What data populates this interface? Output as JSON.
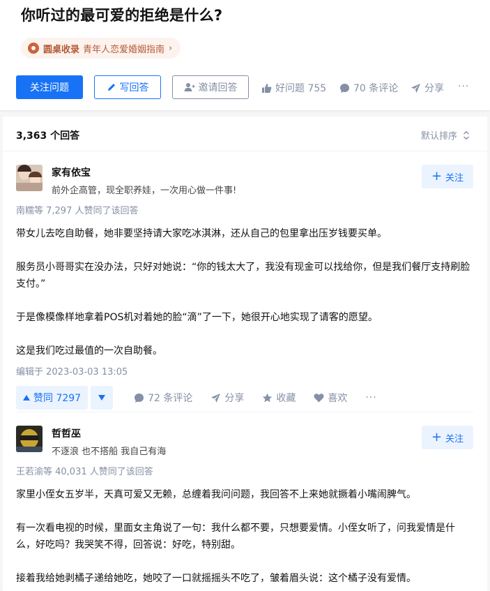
{
  "question": {
    "title": "你听过的最可爱的拒绝是什么?",
    "topic_brand": "圆桌收录",
    "topic_name": "青年人恋爱婚姻指南",
    "follow_label": "关注问题",
    "write_label": "写回答",
    "invite_label": "邀请回答",
    "good_label": "好问题 755",
    "comments_label": "70 条评论",
    "share_label": "分享",
    "more_label": "···"
  },
  "list": {
    "count_label": "3,363 个回答",
    "sort_label": "默认排序"
  },
  "answers": [
    {
      "author_name": "家有依宝",
      "author_bio": "前外企高管，现全职养娃，一次用心做一件事!",
      "follow_label": "关注",
      "votes_line": "南糯等 7,297 人赞同了该回答",
      "paragraphs": [
        "带女儿去吃自助餐，她非要坚持请大家吃冰淇淋，还从自己的包里拿出压岁钱要买单。",
        "服务员小哥哥实在没办法，只好对她说：“你的钱太大了，我没有现金可以找给你，但是我们餐厅支持刷脸支付。”",
        "于是像模像样地拿着POS机对着她的脸“滴”了一下，她很开心地实现了请客的愿望。",
        "这是我们吃过最值的一次自助餐。"
      ],
      "edit_time": "编辑于 2023-03-03 13:05",
      "vote_up_label": "赞同 7297",
      "comments_label": "72 条评论",
      "share_label": "分享",
      "collect_label": "收藏",
      "like_label": "喜欢",
      "more_label": "···"
    },
    {
      "author_name": "哲哲巫",
      "author_bio": "不逐浪 也不搭船 我自己有海",
      "follow_label": "关注",
      "votes_line": "王若渝等 40,031 人赞同了该回答",
      "paragraphs": [
        "家里小侄女五岁半，天真可爱又无赖，总缠着我问问题，我回答不上来她就撅着小嘴闹脾气。",
        "有一次看电视的时候，里面女主角说了一句：我什么都不要，只想要爱情。小侄女听了，问我爱情是什么，好吃吗？我哭笑不得，回答说：好吃，特别甜。",
        "接着我给她剥橘子递给她吃，她咬了一口就摇摇头不吃了，皱着眉头说：这个橘子没有爱情。"
      ]
    }
  ],
  "colors": {
    "primary": "#1772f6",
    "muted": "#8590a6",
    "topic_accent": "#b35a36"
  }
}
